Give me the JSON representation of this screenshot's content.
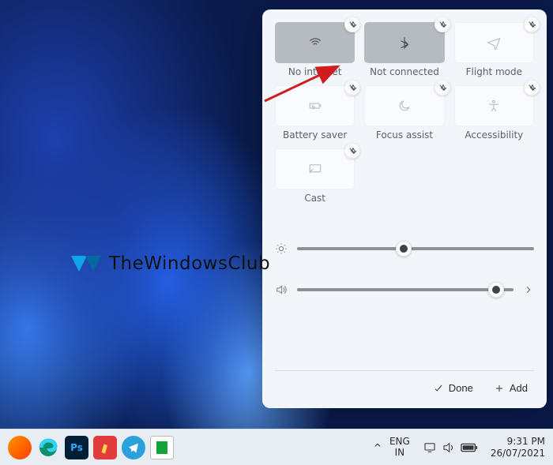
{
  "quick_settings": {
    "tiles": [
      {
        "id": "wifi",
        "label": "No internet",
        "state": "active",
        "icon": "wifi-icon"
      },
      {
        "id": "bluetooth",
        "label": "Not connected",
        "state": "active",
        "icon": "bluetooth-icon"
      },
      {
        "id": "flight",
        "label": "Flight mode",
        "state": "inactive",
        "icon": "airplane-icon"
      },
      {
        "id": "battery",
        "label": "Battery saver",
        "state": "inactive",
        "icon": "battery-saver-icon"
      },
      {
        "id": "focus",
        "label": "Focus assist",
        "state": "inactive",
        "icon": "moon-icon"
      },
      {
        "id": "access",
        "label": "Accessibility",
        "state": "inactive",
        "icon": "accessibility-icon"
      },
      {
        "id": "cast",
        "label": "Cast",
        "state": "inactive",
        "icon": "cast-icon"
      }
    ],
    "sliders": {
      "brightness": {
        "value": 45
      },
      "volume": {
        "value": 92
      }
    },
    "footer": {
      "done": "Done",
      "add": "Add"
    }
  },
  "taskbar": {
    "lang1": "ENG",
    "lang2": "IN",
    "time": "9:31 PM",
    "date": "26/07/2021",
    "tray_chevron": "^"
  },
  "watermark": {
    "text": "TheWindowsClub"
  }
}
